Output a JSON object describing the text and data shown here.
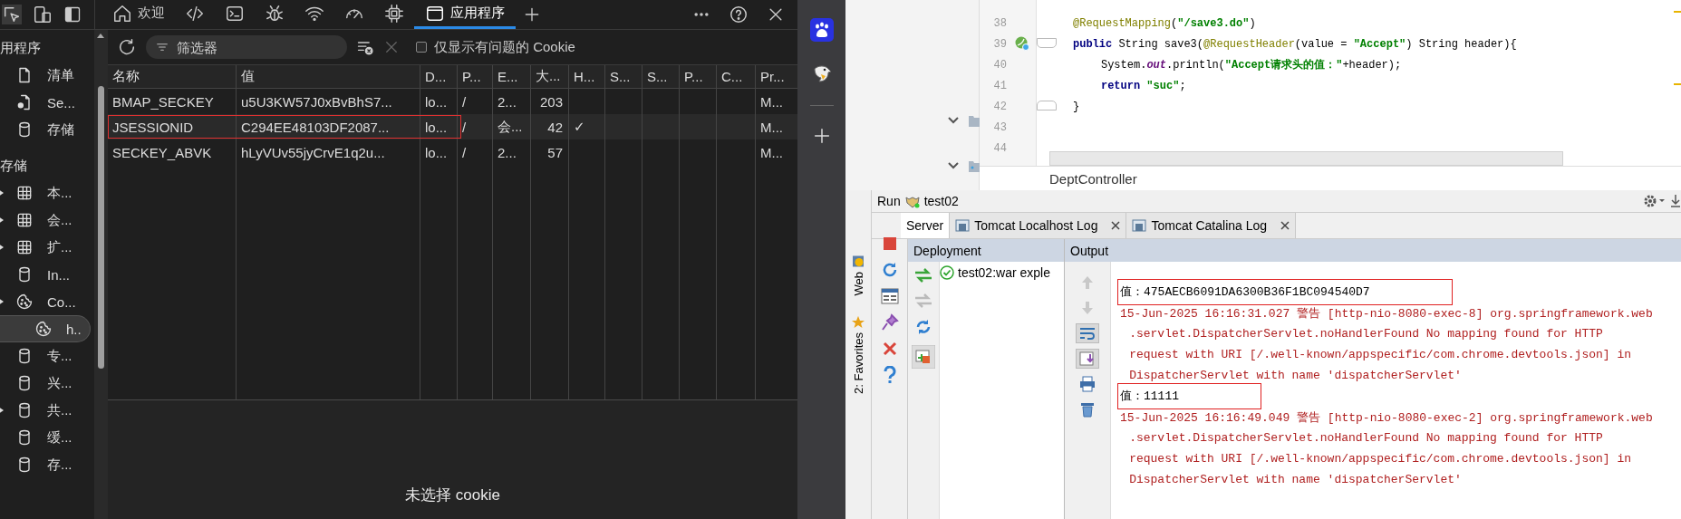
{
  "devtools": {
    "tabs": [
      {
        "kind": "home",
        "label": "欢迎",
        "selected": false
      },
      {
        "kind": "code",
        "selected": false
      },
      {
        "kind": "console",
        "selected": false
      },
      {
        "kind": "bug",
        "selected": false
      },
      {
        "kind": "wifi",
        "selected": false
      },
      {
        "kind": "gauge",
        "selected": false
      },
      {
        "kind": "chip",
        "selected": false
      },
      {
        "kind": "app",
        "label": "应用程序",
        "selected": true
      }
    ],
    "sidebar": {
      "sections": [
        {
          "title": "用程序",
          "items": [
            {
              "label": "清单",
              "kind": "file",
              "selected": false
            },
            {
              "label": "Se...",
              "kind": "gear-file",
              "selected": false
            },
            {
              "label": "存储",
              "kind": "db",
              "selected": false
            }
          ]
        },
        {
          "title": "存储",
          "items": [
            {
              "label": "本...",
              "kind": "table",
              "expandable": true,
              "selected": false
            },
            {
              "label": "会...",
              "kind": "table",
              "expandable": true,
              "selected": false
            },
            {
              "label": "扩...",
              "kind": "table",
              "expandable": true,
              "selected": false
            },
            {
              "label": "In...",
              "kind": "db",
              "selected": false
            },
            {
              "label": "Co...",
              "kind": "cookie",
              "expandable": true,
              "selected": false,
              "children": [
                {
                  "label": "h..",
                  "kind": "cookie",
                  "selected": true
                }
              ]
            },
            {
              "label": "专...",
              "kind": "db",
              "selected": false
            },
            {
              "label": "兴...",
              "kind": "db",
              "selected": false
            },
            {
              "label": "共...",
              "kind": "db",
              "expandable": true,
              "selected": false
            },
            {
              "label": "缓...",
              "kind": "db",
              "selected": false
            },
            {
              "label": "存...",
              "kind": "db",
              "selected": false
            }
          ]
        }
      ]
    },
    "filter": {
      "placeholder": "筛选器"
    },
    "issues_checkbox": {
      "label": "仅显示有问题的 Cookie",
      "checked": false
    },
    "table": {
      "columns": [
        "名称",
        "值",
        "D...",
        "P...",
        "E...",
        "大...",
        "H...",
        "S...",
        "S...",
        "P...",
        "C...",
        "Pr..."
      ],
      "rows": [
        {
          "cells": [
            "BMAP_SECKEY",
            "u5U3KW57J0xBvBhS7...",
            "lo...",
            "/",
            "2...",
            "203",
            null,
            null,
            null,
            null,
            null,
            "M..."
          ],
          "highlighted": false
        },
        {
          "cells": [
            "JSESSIONID",
            "C294EE48103DF2087...",
            "lo...",
            "/",
            "会...",
            "42",
            "✓",
            null,
            null,
            null,
            null,
            "M..."
          ],
          "highlighted": true
        },
        {
          "cells": [
            "SECKEY_ABVK",
            "hLyVUv55jyCrvE1q2u...",
            "lo...",
            "/",
            "2...",
            "57",
            null,
            null,
            null,
            null,
            null,
            "M..."
          ],
          "highlighted": false
        }
      ]
    },
    "empty_state": {
      "title": "未选择 cookie"
    }
  },
  "ide": {
    "editor": {
      "lines": [
        {
          "number": "38",
          "tokens": [
            {
              "kind": "annotation",
              "text": "@RequestMapping"
            },
            {
              "kind": "plain",
              "text": "("
            },
            {
              "kind": "string",
              "text": "\"/save3.do\""
            },
            {
              "kind": "plain",
              "text": ")"
            }
          ]
        },
        {
          "number": "39",
          "run_marker": true,
          "fold_start": true,
          "tokens": [
            {
              "kind": "keyword",
              "text": "public"
            },
            {
              "kind": "plain",
              "text": "String save3("
            },
            {
              "kind": "annotation",
              "text": "@RequestHeader"
            },
            {
              "kind": "plain",
              "text": "(value = "
            },
            {
              "kind": "string",
              "text": "\"Accept\""
            },
            {
              "kind": "plain",
              "text": ") String header){"
            }
          ]
        },
        {
          "number": "40",
          "nested": true,
          "tokens": [
            {
              "kind": "plain",
              "text": "System."
            },
            {
              "kind": "field",
              "text": "out"
            },
            {
              "kind": "plain",
              "text": ".println("
            },
            {
              "kind": "string",
              "text": "\"Accept请求头的值：\""
            },
            {
              "kind": "plain",
              "text": "+header);"
            }
          ]
        },
        {
          "number": "41",
          "nested": true,
          "tokens": [
            {
              "kind": "keyword",
              "text": "return"
            },
            {
              "kind": "string",
              "text": "\"suc\""
            },
            {
              "kind": "plain",
              "text": ";"
            }
          ]
        },
        {
          "number": "42",
          "fold_end": true,
          "tokens": [
            {
              "kind": "plain",
              "text": "}"
            }
          ]
        },
        {
          "number": "43"
        },
        {
          "number": "44"
        }
      ],
      "file_tab": "DeptController"
    },
    "run": {
      "label": "Run",
      "config": "test02",
      "tabs": [
        {
          "label": "Server",
          "selected": true,
          "closable": false
        },
        {
          "label": "Tomcat Localhost Log",
          "selected": false,
          "closable": true
        },
        {
          "label": "Tomcat Catalina Log",
          "selected": false,
          "closable": true
        }
      ]
    },
    "side_labels": [
      "Web",
      "2: Favorites"
    ],
    "deployment": {
      "title": "Deployment",
      "items": [
        {
          "label": "test02:war exple"
        }
      ]
    },
    "output": {
      "title": "Output",
      "lines": [
        {
          "kind": "stdout",
          "text": "值：475AECB6091DA6300B36F1BC094540D7",
          "highlighted": true
        },
        {
          "kind": "stderr",
          "text": "15-Jun-2025 16:16:31.027 警告 [http-nio-8080-exec-8] org.springframework.web"
        },
        {
          "kind": "stderr",
          "continuation": true,
          "text": ".servlet.DispatcherServlet.noHandlerFound No mapping found for HTTP"
        },
        {
          "kind": "stderr",
          "continuation": true,
          "text": "request with URI [/.well-known/appspecific/com.chrome.devtools.json] in"
        },
        {
          "kind": "stderr",
          "continuation": true,
          "text": "DispatcherServlet with name 'dispatcherServlet'"
        },
        {
          "kind": "stdout",
          "text": "值：11111",
          "highlighted": true
        },
        {
          "kind": "stderr",
          "text": "15-Jun-2025 16:16:49.049 警告 [http-nio-8080-exec-2] org.springframework.web"
        },
        {
          "kind": "stderr",
          "continuation": true,
          "text": ".servlet.DispatcherServlet.noHandlerFound No mapping found for HTTP"
        },
        {
          "kind": "stderr",
          "continuation": true,
          "text": "request with URI [/.well-known/appspecific/com.chrome.devtools.json] in"
        },
        {
          "kind": "stderr",
          "continuation": true,
          "text": "DispatcherServlet with name 'dispatcherServlet'"
        }
      ]
    }
  }
}
